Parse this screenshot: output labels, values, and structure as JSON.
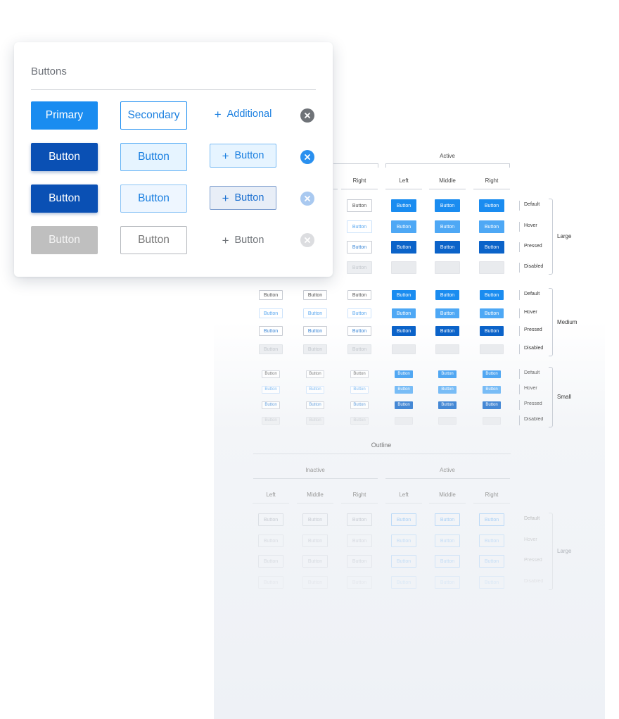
{
  "card": {
    "title": "Buttons",
    "rows": [
      {
        "primary": "Primary",
        "secondary": "Secondary",
        "additional": "Additional",
        "plus": "+"
      },
      {
        "primary": "Button",
        "secondary": "Button",
        "additional": "Button",
        "plus": "+"
      },
      {
        "primary": "Button",
        "secondary": "Button",
        "additional": "Button",
        "plus": "+"
      },
      {
        "primary": "Button",
        "secondary": "Button",
        "additional": "Button",
        "plus": "+"
      }
    ],
    "colors": {
      "accent": "#1a8cf0",
      "accent_dark": "#0a50b4",
      "disabled": "#bfbfbf",
      "clear_default": "#6f7378",
      "clear_hover": "#2a90ef",
      "clear_pressed": "#a9c9f0",
      "clear_disabled": "#dcdde0"
    },
    "icons": [
      "plus-icon",
      "close-circle-icon"
    ]
  },
  "sheet": {
    "top_group": "Active",
    "columns": [
      "Right",
      "Left",
      "Middle",
      "Right"
    ],
    "states": [
      "Default",
      "Hover",
      "Pressed",
      "Disabled"
    ],
    "sizes": [
      "Large",
      "Medium",
      "Small"
    ],
    "button_label": "Button",
    "outline": {
      "title": "Outline",
      "groups": [
        "Inactive",
        "Active"
      ],
      "columns": [
        "Left",
        "Middle",
        "Right",
        "Left",
        "Middle",
        "Right"
      ],
      "states": [
        "Default",
        "Hover",
        "Pressed",
        "Disabled"
      ],
      "size": "Large"
    }
  }
}
